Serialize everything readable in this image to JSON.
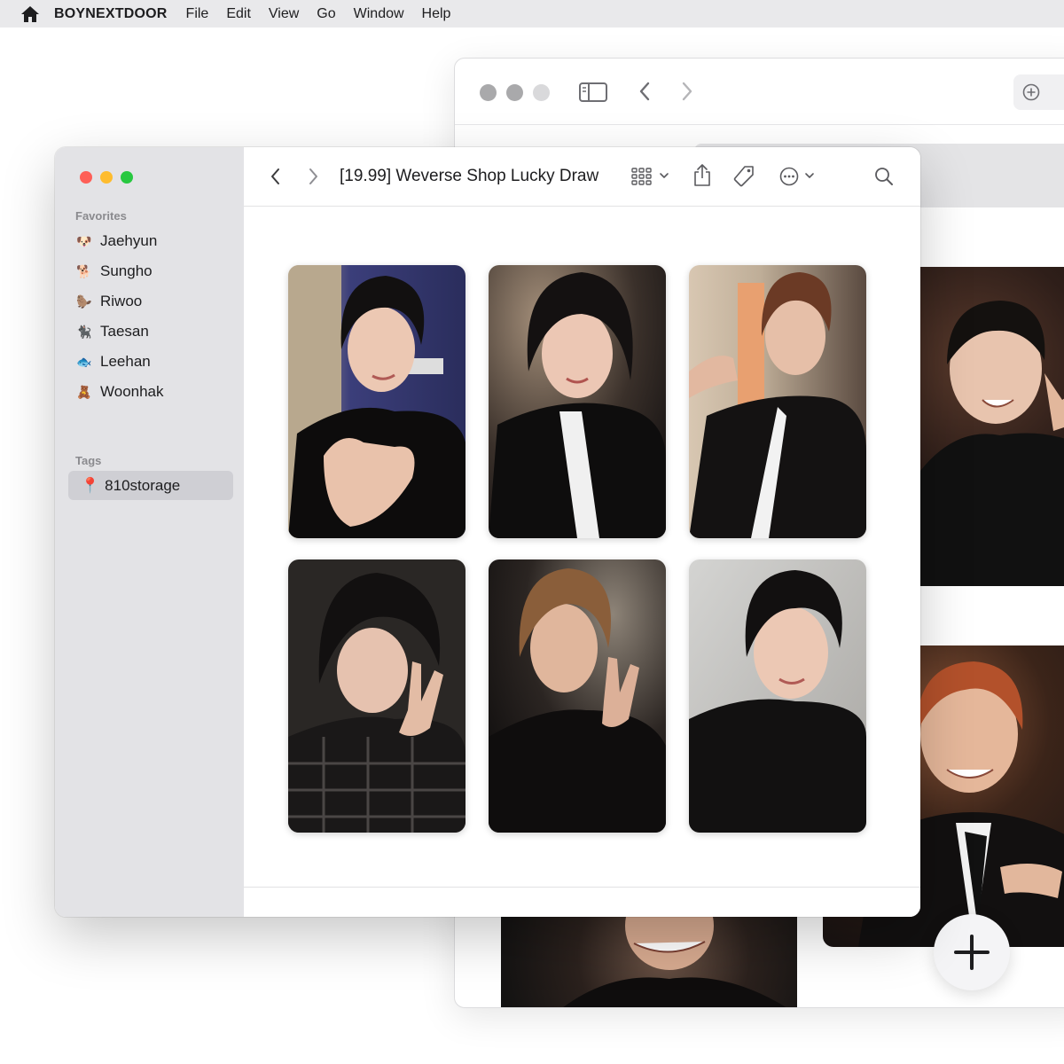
{
  "menubar": {
    "icon": "home-icon",
    "app_name": "BOYNEXTDOOR",
    "items": [
      "File",
      "Edit",
      "View",
      "Go",
      "Window",
      "Help"
    ]
  },
  "finder": {
    "title": "[19.99] Weverse Shop Lucky Draw",
    "toolbar_icons": [
      "back-chevron-icon",
      "forward-chevron-icon",
      "grid-view-icon",
      "share-icon",
      "tag-icon",
      "more-icon",
      "search-icon"
    ],
    "sidebar": {
      "favorites_label": "Favorites",
      "favorites": [
        {
          "emoji": "🐶",
          "label": "Jaehyun"
        },
        {
          "emoji": "🐕",
          "label": "Sungho"
        },
        {
          "emoji": "🦫",
          "label": "Riwoo"
        },
        {
          "emoji": "🐈‍⬛",
          "label": "Taesan"
        },
        {
          "emoji": "🐟",
          "label": "Leehan"
        },
        {
          "emoji": "🧸",
          "label": "Woonhak"
        }
      ],
      "tags_label": "Tags",
      "tags": [
        {
          "emoji": "📍",
          "label": "810storage"
        }
      ]
    },
    "photocard_count": 6
  },
  "colors": {
    "menubar_bg": "#e9e9eb",
    "sidebar_bg": "#e3e3e6",
    "selected_tag_bg": "#cfcfd4",
    "traffic_red": "#fe5f57",
    "traffic_yellow": "#febc2e",
    "traffic_green": "#28c840"
  }
}
